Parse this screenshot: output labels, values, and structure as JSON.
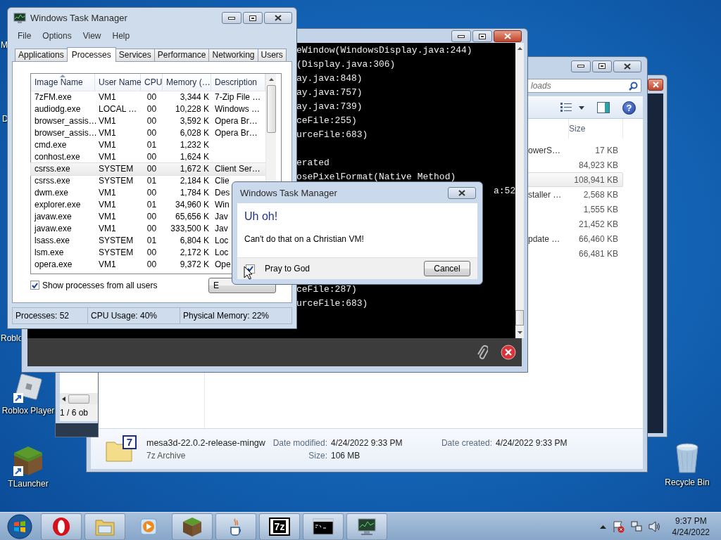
{
  "desktop_icons": [
    {
      "label": "M",
      "kind": "fragment"
    },
    {
      "label": "D",
      "kind": "fragment"
    },
    {
      "label": "Roblo",
      "kind": "fragment"
    },
    {
      "label": "Roblox Player",
      "kind": "roblox"
    },
    {
      "label": "TLauncher",
      "kind": "grass"
    },
    {
      "label": "Recycle Bin",
      "kind": "bin"
    }
  ],
  "explorer": {
    "search": {
      "placeholder": "loads"
    },
    "help_glyph": "?",
    "columns": [
      "Size"
    ],
    "rows": [
      {
        "name": "owerS…",
        "size": "17 KB",
        "selected": false
      },
      {
        "size": "84,923 KB",
        "selected": false
      },
      {
        "size": "108,941 KB",
        "selected": true
      },
      {
        "name": "staller …",
        "size": "2,568 KB",
        "selected": false
      },
      {
        "size": "1,555 KB",
        "selected": false
      },
      {
        "size": "21,452 KB",
        "selected": false
      },
      {
        "name": "pdate …",
        "size": "66,460 KB",
        "selected": false
      },
      {
        "size": "66,481 KB",
        "selected": false
      }
    ],
    "details": {
      "icon_label": "7",
      "name": "mesa3d-22.0.2-release-mingw",
      "type": "7z Archive",
      "fields": [
        {
          "label": "Date modified:",
          "value": "4/24/2022 9:33 PM"
        },
        {
          "label": "Size:",
          "value": "106 MB"
        },
        {
          "label": "Date created:",
          "value": "4/24/2022 9:33 PM"
        }
      ]
    }
  },
  "archive_window": {
    "status": "1 / 6 ob"
  },
  "console": {
    "lines": [
      {
        "kind": "line",
        "text": "eWindow(WindowsDisplay.java:244)"
      },
      {
        "kind": "line",
        "text": "(Display.java:306)"
      },
      {
        "kind": "line",
        "text": "ay.java:848)"
      },
      {
        "kind": "line",
        "text": "ay.java:757)"
      },
      {
        "kind": "line",
        "text": "ay.java:739)"
      },
      {
        "kind": "line",
        "text": "ceFile:255)"
      },
      {
        "kind": "line",
        "text": "urceFile:683)"
      },
      {
        "kind": "blank"
      },
      {
        "kind": "line",
        "text": "erated"
      },
      {
        "kind": "line",
        "text": "osePixelFormat(Native Method)"
      },
      {
        "kind": "tail",
        "text": "a:52"
      },
      {
        "kind": "blank"
      },
      {
        "kind": "blank"
      },
      {
        "kind": "blank"
      },
      {
        "kind": "blank"
      },
      {
        "kind": "blank"
      },
      {
        "kind": "blank"
      },
      {
        "kind": "line",
        "text": "ceFile:287)"
      },
      {
        "kind": "line",
        "text": "urceFile:683)"
      }
    ]
  },
  "task_manager": {
    "title": "Windows Task Manager",
    "menu": [
      "File",
      "Options",
      "View",
      "Help"
    ],
    "tabs": [
      {
        "label": "Applications",
        "selected": false
      },
      {
        "label": "Processes",
        "selected": true
      },
      {
        "label": "Services",
        "selected": false
      },
      {
        "label": "Performance",
        "selected": false
      },
      {
        "label": "Networking",
        "selected": false
      },
      {
        "label": "Users",
        "selected": false
      }
    ],
    "columns": [
      "Image Name",
      "User Name",
      "CPU",
      "Memory (…",
      "Description"
    ],
    "rows": [
      {
        "cells": [
          "7zFM.exe",
          "VM1",
          "00",
          "3,344 K",
          "7-Zip File …"
        ],
        "selected": false
      },
      {
        "cells": [
          "audiodg.exe",
          "LOCAL …",
          "00",
          "10,228 K",
          "Windows …"
        ],
        "selected": false
      },
      {
        "cells": [
          "browser_assis…",
          "VM1",
          "00",
          "3,592 K",
          "Opera Br…"
        ],
        "selected": false
      },
      {
        "cells": [
          "browser_assis…",
          "VM1",
          "00",
          "6,028 K",
          "Opera Br…"
        ],
        "selected": false
      },
      {
        "cells": [
          "cmd.exe",
          "VM1",
          "01",
          "1,232 K"
        ],
        "selected": false
      },
      {
        "cells": [
          "conhost.exe",
          "VM1",
          "00",
          "1,624 K"
        ],
        "selected": false
      },
      {
        "cells": [
          "csrss.exe",
          "SYSTEM",
          "00",
          "1,672 K",
          "Client Ser…"
        ],
        "selected": true
      },
      {
        "cells": [
          "csrss.exe",
          "SYSTEM",
          "01",
          "2,184 K",
          "Clie"
        ],
        "selected": false
      },
      {
        "cells": [
          "dwm.exe",
          "VM1",
          "00",
          "1,784 K",
          "Des"
        ],
        "selected": false
      },
      {
        "cells": [
          "explorer.exe",
          "VM1",
          "01",
          "34,960 K",
          "Win"
        ],
        "selected": false
      },
      {
        "cells": [
          "javaw.exe",
          "VM1",
          "00",
          "65,656 K",
          "Jav"
        ],
        "selected": false
      },
      {
        "cells": [
          "javaw.exe",
          "VM1",
          "00",
          "333,500 K",
          "Jav"
        ],
        "selected": false
      },
      {
        "cells": [
          "lsass.exe",
          "SYSTEM",
          "01",
          "6,804 K",
          "Loc"
        ],
        "selected": false
      },
      {
        "cells": [
          "lsm.exe",
          "SYSTEM",
          "00",
          "2,172 K",
          "Loc"
        ],
        "selected": false
      },
      {
        "cells": [
          "opera.exe",
          "VM1",
          "00",
          "9,372 K",
          "Ope"
        ],
        "selected": false
      }
    ],
    "show_all_users": {
      "label": "Show processes from all users",
      "checked": true
    },
    "end_button": "E",
    "status": [
      "Processes: 52",
      "CPU Usage: 40%",
      "Physical Memory: 22%"
    ]
  },
  "dialog": {
    "title": "Windows Task Manager",
    "heading": "Uh oh!",
    "message": "Can't do that on a Christian VM!",
    "checkbox": {
      "label": "Pray to God",
      "checked": true
    },
    "button": "Cancel"
  },
  "taskbar": {
    "apps": [
      {
        "kind": "opera",
        "running": true
      },
      {
        "kind": "folder",
        "running": true
      },
      {
        "kind": "media",
        "running": false
      },
      {
        "kind": "grass",
        "running": true
      },
      {
        "kind": "java",
        "running": true
      },
      {
        "kind": "archive",
        "label": "7z",
        "running": true
      },
      {
        "kind": "terminal",
        "running": true
      },
      {
        "kind": "monitor",
        "running": true
      }
    ],
    "clock": {
      "time": "9:37 PM",
      "date": "4/24/2022"
    }
  }
}
